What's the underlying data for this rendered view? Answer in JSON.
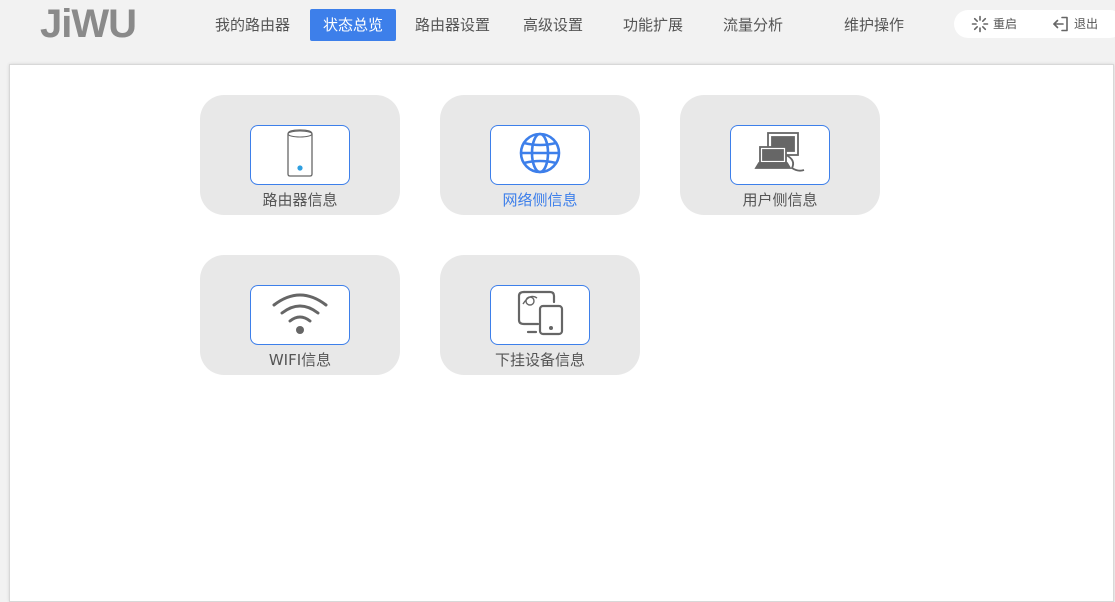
{
  "brand": {
    "logo_text": "JiWU"
  },
  "nav": {
    "items": [
      {
        "label": "我的路由器"
      },
      {
        "label": "状态总览",
        "active": true
      },
      {
        "label": "路由器设置"
      },
      {
        "label": "高级设置"
      },
      {
        "label": "功能扩展"
      },
      {
        "label": "流量分析"
      },
      {
        "label": "维护操作"
      }
    ]
  },
  "actions": {
    "restart_label": "重启",
    "logout_label": "退出"
  },
  "tiles": [
    {
      "label": "路由器信息",
      "icon": "router-icon"
    },
    {
      "label": "网络侧信息",
      "icon": "globe-icon",
      "highlighted": true
    },
    {
      "label": "用户侧信息",
      "icon": "computer-icon"
    },
    {
      "label": "WIFI信息",
      "icon": "wifi-icon"
    },
    {
      "label": "下挂设备信息",
      "icon": "devices-icon"
    }
  ],
  "colors": {
    "accent": "#3d7fea",
    "icon_gray": "#666666",
    "tile_bg": "#e8e8e8"
  }
}
